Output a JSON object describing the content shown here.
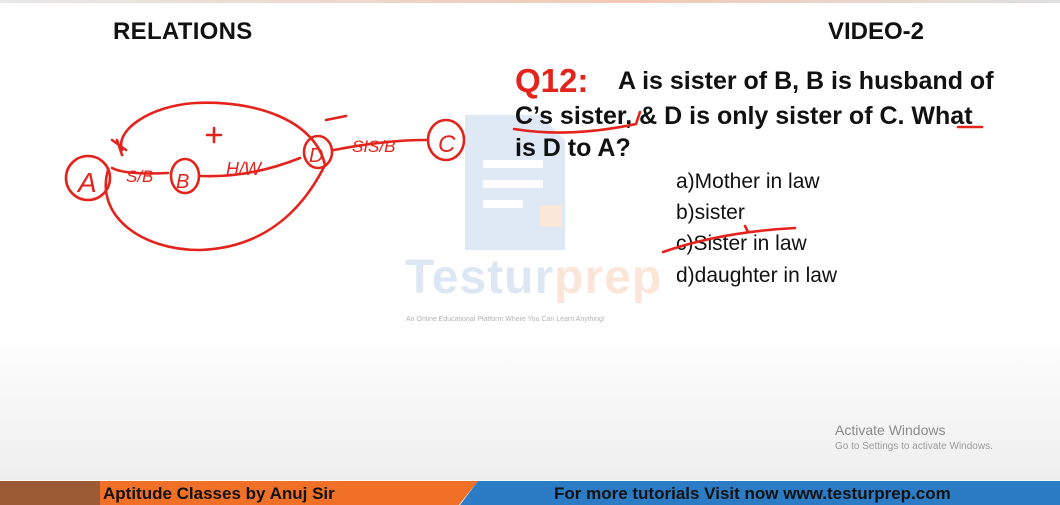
{
  "header": {
    "topic": "RELATIONS",
    "video": "VIDEO-2"
  },
  "question": {
    "number": "Q12:",
    "line1": "A is sister of B, B is husband of",
    "line2": "C’s sister, & D is only sister of C. What",
    "line3": "is D to A?"
  },
  "options": [
    {
      "label": "a)Mother in law"
    },
    {
      "label": "b)sister"
    },
    {
      "label": "c)Sister in law",
      "marked": true
    },
    {
      "label": "d)daughter in law"
    }
  ],
  "annotation": {
    "nodes": [
      "A",
      "B",
      "D",
      "C"
    ],
    "links": [
      "S/B",
      "H/W",
      "SIS/B"
    ],
    "signs": [
      "+",
      "-"
    ]
  },
  "watermark": {
    "brand_a": "Testur",
    "brand_b": "prep",
    "tagline": "An Online Educational Platform Where You Can Learn Anything!"
  },
  "activation": {
    "title": "Activate Windows",
    "subtitle": "Go to Settings to activate Windows."
  },
  "footer": {
    "left": "Aptitude Classes by Anuj Sir",
    "right": "For more tutorials Visit now www.testurprep.com"
  },
  "colors": {
    "accent_red": "#e3231c",
    "footer_orange": "#ef7026",
    "footer_blue": "#2b7cc4"
  }
}
